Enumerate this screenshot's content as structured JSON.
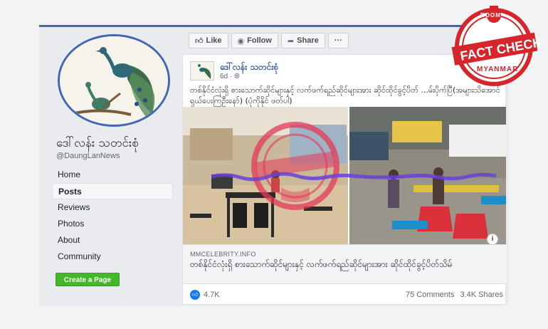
{
  "page": {
    "name": "ဒေါ်လန်း သတင်းစုံ",
    "handle": "@DaungLanNews"
  },
  "sidebar": {
    "items": [
      {
        "label": "Home",
        "active": false
      },
      {
        "label": "Posts",
        "active": true
      },
      {
        "label": "Reviews",
        "active": false
      },
      {
        "label": "Photos",
        "active": false
      },
      {
        "label": "About",
        "active": false
      },
      {
        "label": "Community",
        "active": false
      }
    ],
    "create_label": "Create a Page"
  },
  "actions": {
    "like": "Like",
    "follow": "Follow",
    "share": "Share",
    "more": "···"
  },
  "post": {
    "author": "ဒေါ်လန်း သတင်းစုံ",
    "time": "6d ·",
    "text": "တစ်နိုင်ငံလုံးရှိ စားသောက်ဆိုင်များနှင့် လက်ဖက်ရည်ဆိုင်များအား ဆိုင်ထိုင်ခွင့်ပိတ် ...မ်းပိုက်ပြီ(အများသိအောင်ရှယ်ပေးကြဦးနော်) (ပုံကိုနိုင် ဖတ်ပါ)",
    "link": {
      "domain": "MMCELEBRITY.INFO",
      "title": "တစ်နိုင်ငံလုံးရှိ စားသောက်ဆိုင်များနှင့် လက်ဖက်ရည်ဆိုင်များအား ဆိုင်ထိုင်ခွင့်ပိတ်သိမ်",
      "info": "i"
    },
    "likes": "4.7K",
    "comments": "75 Comments",
    "shares": "3.4K Shares"
  },
  "stamp": {
    "top": "BOOM",
    "middle": "FACT CHECK",
    "bottom": "MYANMAR"
  },
  "colors": {
    "fb_blue": "#4267b2",
    "stamp_red": "#d7262b",
    "green": "#42b72a"
  }
}
